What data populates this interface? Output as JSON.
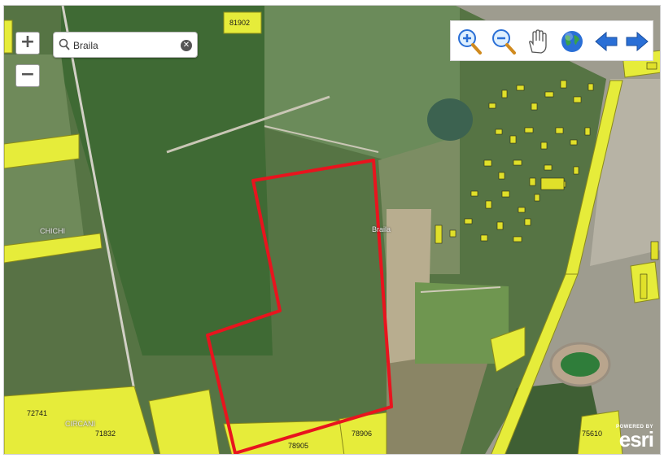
{
  "search": {
    "value": "Braila",
    "clear_icon": "close-icon"
  },
  "zoom": {
    "in_label": "+",
    "out_label": "−"
  },
  "toolbar": {
    "tools": [
      {
        "name": "zoom-in-tool",
        "icon": "magnifier-plus-icon"
      },
      {
        "name": "zoom-out-tool",
        "icon": "magnifier-minus-icon"
      },
      {
        "name": "pan-tool",
        "icon": "hand-icon"
      },
      {
        "name": "full-extent-tool",
        "icon": "globe-icon"
      },
      {
        "name": "previous-extent-tool",
        "icon": "arrow-left-icon"
      },
      {
        "name": "next-extent-tool",
        "icon": "arrow-right-icon"
      }
    ]
  },
  "parcel_labels": [
    "81902",
    "72741",
    "71832",
    "78905",
    "78906",
    "75610"
  ],
  "place_labels": [
    "CHICHI",
    "CIRCANI",
    "Braila"
  ],
  "attribution": {
    "powered": "POWERED BY",
    "brand": "esri"
  },
  "colors": {
    "parcel_fill": "#e6ec3a",
    "parcel_outline": "#8a8a1a",
    "selection_outline": "#e8141e",
    "toolbar_icon_blue": "#2a6fd6"
  }
}
